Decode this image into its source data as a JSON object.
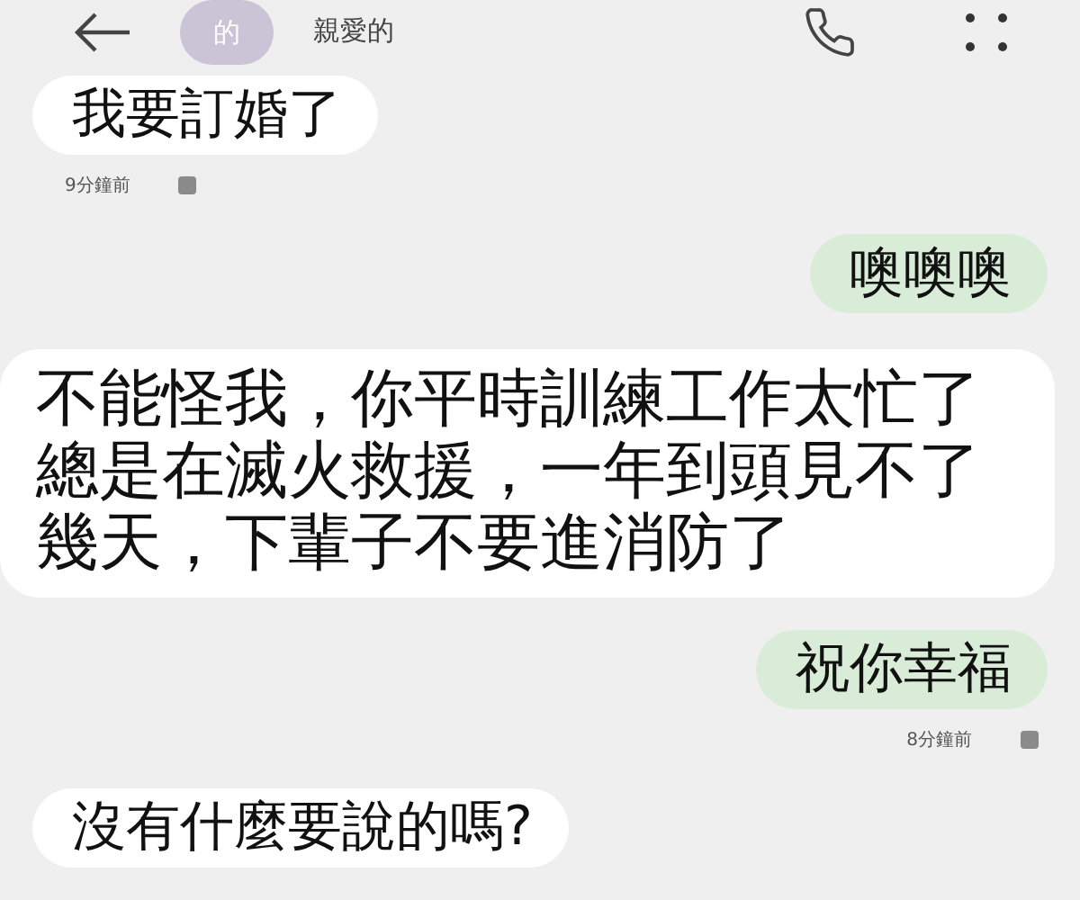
{
  "header": {
    "avatar": "的",
    "name": "親愛的"
  },
  "messages": [
    {
      "kind": "received",
      "text": "我要訂婚了",
      "time": "9分鐘前"
    },
    {
      "kind": "sent",
      "text": "噢噢噢"
    },
    {
      "kind": "received",
      "text": "不能怪我，你平時訓練工作太忙了總是在滅火救援，一年到頭見不了幾天，下輩子不要進消防了"
    },
    {
      "kind": "sent",
      "text": "祝你幸福",
      "time": "8分鐘前"
    },
    {
      "kind": "received",
      "text": "沒有什麼要說的嗎?"
    }
  ]
}
